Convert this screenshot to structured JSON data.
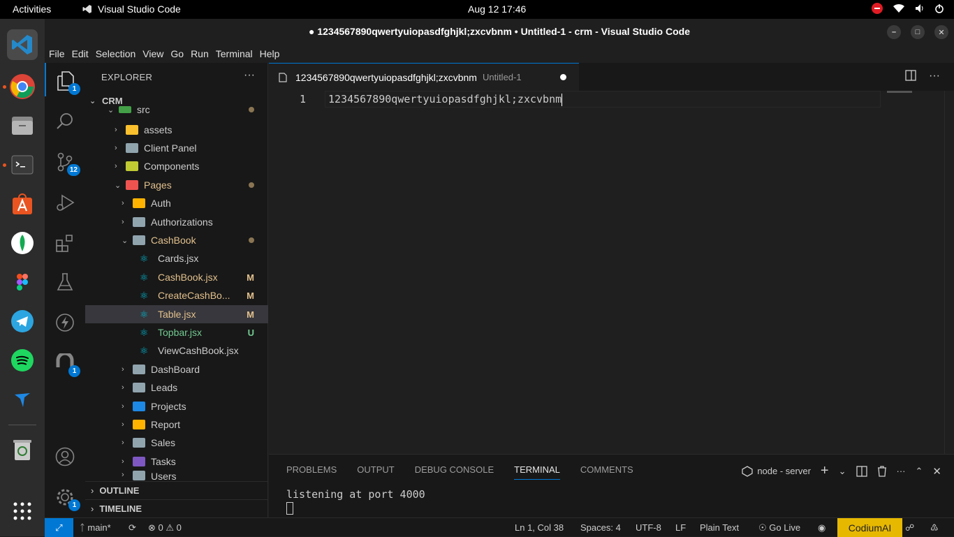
{
  "system": {
    "activities": "Activities",
    "app_name": "Visual Studio Code",
    "clock": "Aug 12  17:46"
  },
  "window": {
    "title": "● 1234567890qwertyuiopasdfghjkl;zxcvbnm • Untitled-1 - crm - Visual Studio Code"
  },
  "menu": [
    "File",
    "Edit",
    "Selection",
    "View",
    "Go",
    "Run",
    "Terminal",
    "Help"
  ],
  "activitybar": {
    "explorer_badge": "1",
    "scm_badge": "12",
    "remote_badge": "1",
    "settings_badge": "1"
  },
  "explorer": {
    "header": "EXPLORER",
    "root": "CRM",
    "items": [
      {
        "label": "src",
        "chevron": "⌄",
        "color": "#cccccc",
        "status": ""
      },
      {
        "label": "assets",
        "chevron": "›",
        "color": "#cccccc",
        "status": ""
      },
      {
        "label": "Client Panel",
        "chevron": "›",
        "color": "#cccccc",
        "status": ""
      },
      {
        "label": "Components",
        "chevron": "›",
        "color": "#cccccc",
        "status": ""
      },
      {
        "label": "Pages",
        "chevron": "⌄",
        "color": "#cca700",
        "status": ""
      },
      {
        "label": "Auth",
        "chevron": "›",
        "color": "#cccccc",
        "status": ""
      },
      {
        "label": "Authorizations",
        "chevron": "›",
        "color": "#cccccc",
        "status": ""
      },
      {
        "label": "CashBook",
        "chevron": "⌄",
        "color": "#cca700",
        "status": ""
      },
      {
        "label": "Cards.jsx",
        "chevron": "",
        "color": "#cccccc",
        "status": ""
      },
      {
        "label": "CashBook.jsx",
        "chevron": "",
        "color": "#e2c08d",
        "status": "M"
      },
      {
        "label": "CreateCashBo...",
        "chevron": "",
        "color": "#e2c08d",
        "status": "M"
      },
      {
        "label": "Table.jsx",
        "chevron": "",
        "color": "#e2c08d",
        "status": "M"
      },
      {
        "label": "Topbar.jsx",
        "chevron": "",
        "color": "#73c991",
        "status": "U"
      },
      {
        "label": "ViewCashBook.jsx",
        "chevron": "",
        "color": "#cccccc",
        "status": ""
      },
      {
        "label": "DashBoard",
        "chevron": "›",
        "color": "#cccccc",
        "status": ""
      },
      {
        "label": "Leads",
        "chevron": "›",
        "color": "#cccccc",
        "status": ""
      },
      {
        "label": "Projects",
        "chevron": "›",
        "color": "#cccccc",
        "status": ""
      },
      {
        "label": "Report",
        "chevron": "›",
        "color": "#cccccc",
        "status": ""
      },
      {
        "label": "Sales",
        "chevron": "›",
        "color": "#cccccc",
        "status": ""
      },
      {
        "label": "Tasks",
        "chevron": "›",
        "color": "#cccccc",
        "status": ""
      },
      {
        "label": "Users",
        "chevron": "›",
        "color": "#cccccc",
        "status": ""
      }
    ],
    "outline": "OUTLINE",
    "timeline": "TIMELINE"
  },
  "editor": {
    "tab_label": "1234567890qwertyuiopasdfghjkl;zxcvbnm",
    "tab_sub": "Untitled-1",
    "line_number": "1",
    "line_text": "1234567890qwertyuiopasdfghjkl;zxcvbnm"
  },
  "panel": {
    "tabs": [
      "PROBLEMS",
      "OUTPUT",
      "DEBUG CONSOLE",
      "TERMINAL",
      "COMMENTS"
    ],
    "active_tab": "TERMINAL",
    "terminal_name": "node - server",
    "terminal_output": "listening at port 4000"
  },
  "status": {
    "branch": "main*",
    "errors": "0",
    "warnings": "0",
    "position": "Ln 1, Col 38",
    "spaces": "Spaces: 4",
    "encoding": "UTF-8",
    "eol": "LF",
    "language": "Plain Text",
    "golive": "Go Live",
    "codium": "CodiumAI"
  }
}
